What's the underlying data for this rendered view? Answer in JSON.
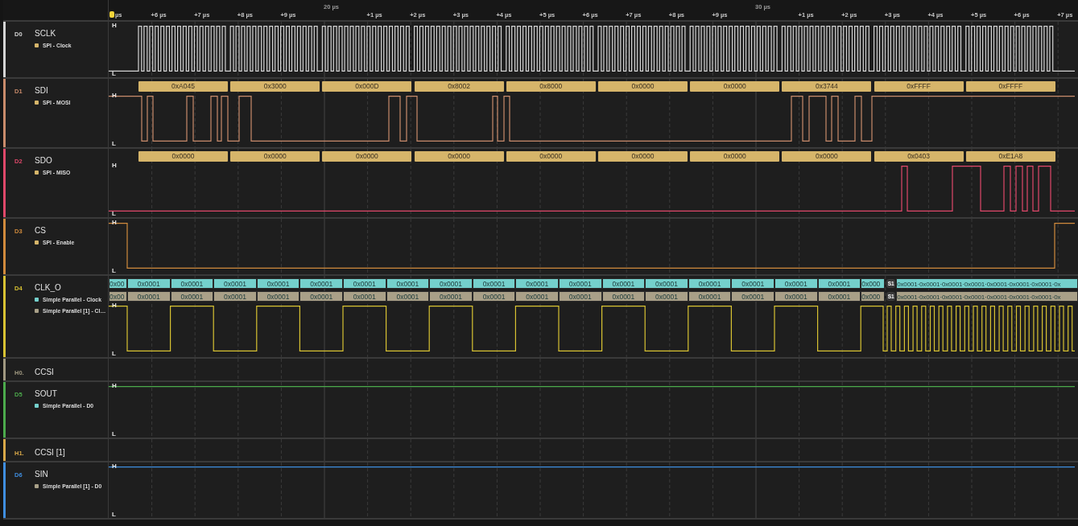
{
  "timeline": {
    "ticks": [
      {
        "label": "µs",
        "kind": "minor"
      },
      {
        "label": "+6 µs",
        "kind": "minor"
      },
      {
        "label": "+7 µs",
        "kind": "minor"
      },
      {
        "label": "+8 µs",
        "kind": "minor"
      },
      {
        "label": "+9 µs",
        "kind": "minor"
      },
      {
        "label": "20 µs",
        "kind": "major"
      },
      {
        "label": "+1 µs",
        "kind": "minor"
      },
      {
        "label": "+2 µs",
        "kind": "minor"
      },
      {
        "label": "+3 µs",
        "kind": "minor"
      },
      {
        "label": "+4 µs",
        "kind": "minor"
      },
      {
        "label": "+5 µs",
        "kind": "minor"
      },
      {
        "label": "+6 µs",
        "kind": "minor"
      },
      {
        "label": "+7 µs",
        "kind": "minor"
      },
      {
        "label": "+8 µs",
        "kind": "minor"
      },
      {
        "label": "+9 µs",
        "kind": "minor"
      },
      {
        "label": "30 µs",
        "kind": "major"
      },
      {
        "label": "+1 µs",
        "kind": "minor"
      },
      {
        "label": "+2 µs",
        "kind": "minor"
      },
      {
        "label": "+3 µs",
        "kind": "minor"
      },
      {
        "label": "+4 µs",
        "kind": "minor"
      },
      {
        "label": "+5 µs",
        "kind": "minor"
      },
      {
        "label": "+6 µs",
        "kind": "minor"
      },
      {
        "label": "+7 µs",
        "kind": "minor"
      }
    ]
  },
  "channels": [
    {
      "id": "D0",
      "name": "SCLK",
      "kind": "signal",
      "color": "#d4d4d4",
      "high": "H",
      "low": "L",
      "decoders": [
        {
          "label": "SPI - Clock",
          "color": "#d6b56a"
        }
      ]
    },
    {
      "id": "D1",
      "name": "SDI",
      "kind": "signal",
      "color": "#c98b6b",
      "high": "H",
      "low": "L",
      "decoders": [
        {
          "label": "SPI - MOSI",
          "color": "#d6b56a"
        }
      ],
      "frame_rows": [
        {
          "kind": "spi",
          "color": "#d6b56a",
          "frames": [
            "0xA045",
            "0x3000",
            "0x000D",
            "0x8002",
            "0x8000",
            "0x0000",
            "0x0000",
            "0x3744",
            "0xFFFF",
            "0xFFFF"
          ]
        }
      ]
    },
    {
      "id": "D2",
      "name": "SDO",
      "kind": "signal",
      "color": "#e0486a",
      "high": "H",
      "low": "L",
      "decoders": [
        {
          "label": "SPI - MISO",
          "color": "#d6b56a"
        }
      ],
      "frame_rows": [
        {
          "kind": "spi",
          "color": "#d6b56a",
          "frames": [
            "0x0000",
            "0x0000",
            "0x0000",
            "0x0000",
            "0x0000",
            "0x0000",
            "0x0000",
            "0x0000",
            "0x0403",
            "0xE1A8"
          ]
        }
      ]
    },
    {
      "id": "D3",
      "name": "CS",
      "kind": "signal",
      "color": "#d08a3c",
      "high": "H",
      "low": "L",
      "decoders": [
        {
          "label": "SPI - Enable",
          "color": "#d6b56a"
        }
      ]
    },
    {
      "id": "D4",
      "name": "CLK_O",
      "kind": "signal",
      "color": "#d8c232",
      "high": "H",
      "low": "L",
      "decoders": [
        {
          "label": "Simple Parallel - Clock",
          "color": "#74d0cc"
        },
        {
          "label": "Simple Parallel [1] - Cl…",
          "color": "#a9a088"
        }
      ],
      "frame_rows": [
        {
          "kind": "parallel",
          "color": "#74d0cc",
          "lead": "0x00",
          "frames": [
            "0x0001",
            "0x0001",
            "0x0001",
            "0x0001",
            "0x0001",
            "0x0001",
            "0x0001",
            "0x0001",
            "0x0001",
            "0x0001",
            "0x0001",
            "0x0001",
            "0x0001",
            "0x0001",
            "0x0001",
            "0x0001",
            "0x0001"
          ],
          "tail": "0x000",
          "marker": "S1",
          "dense": "0x0001·0x0001·0x0001·0x0001·0x0001·0x0001·0x0001·0x"
        },
        {
          "kind": "parallel",
          "color": "#a9a088",
          "lead": "0x00",
          "frames": [
            "0x0001",
            "0x0001",
            "0x0001",
            "0x0001",
            "0x0001",
            "0x0001",
            "0x0001",
            "0x0001",
            "0x0001",
            "0x0001",
            "0x0001",
            "0x0001",
            "0x0001",
            "0x0001",
            "0x0001",
            "0x0001",
            "0x0001"
          ],
          "tail": "0x000",
          "marker": "S1",
          "dense": "0x0001·0x0001·0x0001·0x0001·0x0001·0x0001·0x0001·0x"
        }
      ]
    },
    {
      "id": "H0.",
      "name": "CCSI",
      "kind": "group",
      "color": "#a09880"
    },
    {
      "id": "D5",
      "name": "SOUT",
      "kind": "signal",
      "color": "#4caa4c",
      "high": "H",
      "low": "L",
      "decoders": [
        {
          "label": "Simple Parallel - D0",
          "color": "#74d0cc"
        }
      ]
    },
    {
      "id": "H1.",
      "name": "CCSI [1]",
      "kind": "group",
      "color": "#d8a848"
    },
    {
      "id": "D6",
      "name": "SIN",
      "kind": "signal",
      "color": "#3f8ee0",
      "high": "H",
      "low": "L",
      "decoders": [
        {
          "label": "Simple Parallel [1] - D0",
          "color": "#a9a088"
        }
      ]
    }
  ]
}
